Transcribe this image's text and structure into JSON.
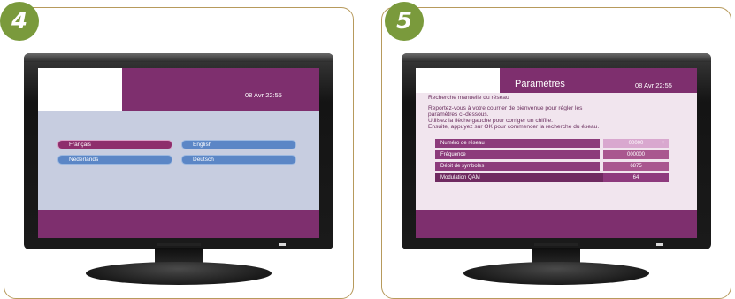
{
  "steps": {
    "left": {
      "number": "4",
      "datetime": "08 Avr 22:55",
      "languages": [
        {
          "label": "Français",
          "selected": true
        },
        {
          "label": "English",
          "selected": false
        },
        {
          "label": "Nederlands",
          "selected": false
        },
        {
          "label": "Deutsch",
          "selected": false
        }
      ]
    },
    "right": {
      "number": "5",
      "title": "Paramètres",
      "datetime": "08 Avr 22:55",
      "subtitle": "Recherche manuelle du réseau",
      "instructions": [
        "Reportez-vous à votre courrier de bienvenue pour régler les",
        "paramètres ci-dessous.",
        "Utilisez la flèche gauche pour corriger un chiffre.",
        "Ensuite, appuyez sur OK pour commencer la recherche du éseau."
      ],
      "parameters": [
        {
          "label": "Numéro de réseau",
          "value": "00000",
          "spinner": "÷"
        },
        {
          "label": "Fréquence",
          "value": "000000"
        },
        {
          "label": "Débit de symboles",
          "value": "6875"
        },
        {
          "label": "Modulation QAM",
          "value": "64"
        }
      ]
    }
  },
  "colors": {
    "frame": "#b79a5c",
    "step_badge": "#7a9a3c",
    "brand_purple": "#7e2f6e",
    "screen_blue": "#c7cde0",
    "button_blue": "#5b86c6"
  }
}
